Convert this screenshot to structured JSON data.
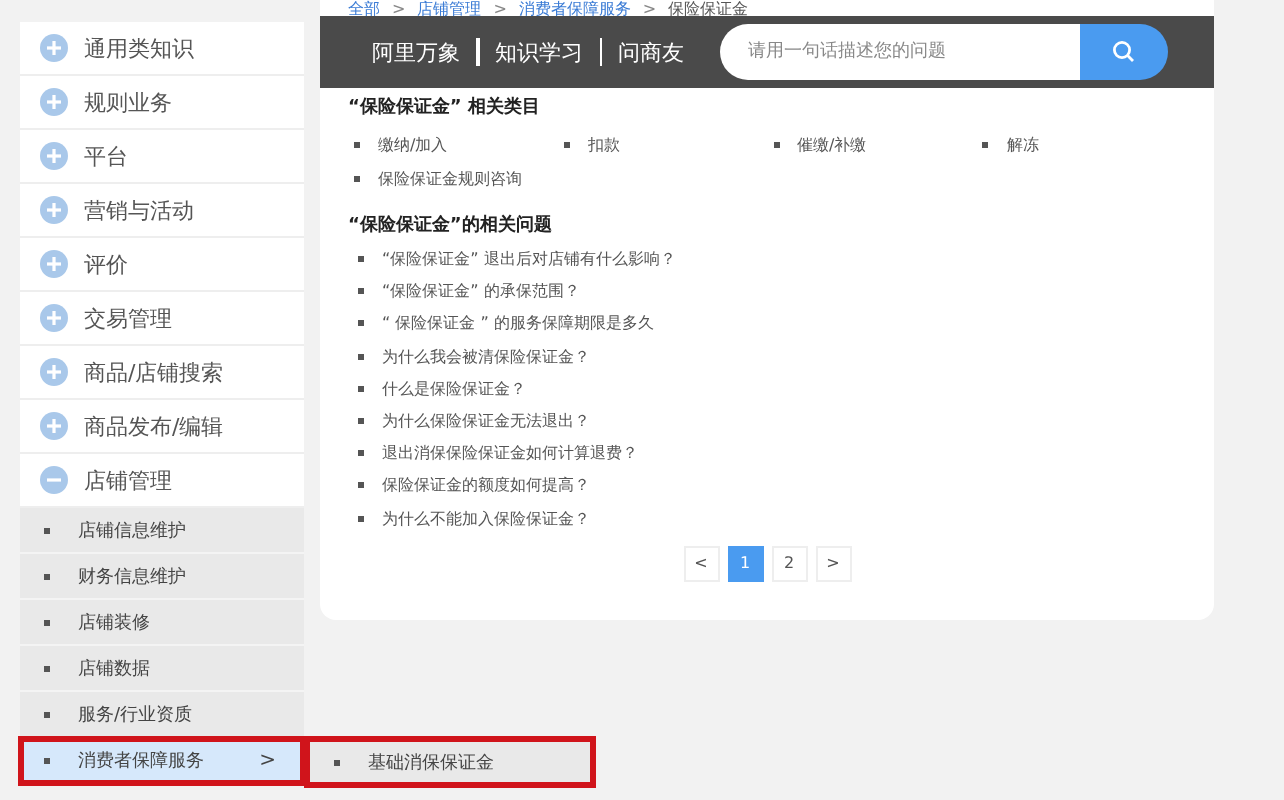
{
  "breadcrumb": [
    "全部",
    "店铺管理",
    "消费者保障服务",
    "保险保证金"
  ],
  "breadcrumb_separator": ">",
  "header_nav": [
    "阿里万象",
    "知识学习",
    "问商友"
  ],
  "search": {
    "placeholder": "请用一句话描述您的问题"
  },
  "sidebar": {
    "items": [
      {
        "label": "通用类知识",
        "expanded": false
      },
      {
        "label": "规则业务",
        "expanded": false
      },
      {
        "label": "平台",
        "expanded": false
      },
      {
        "label": "营销与活动",
        "expanded": false
      },
      {
        "label": "评价",
        "expanded": false
      },
      {
        "label": "交易管理",
        "expanded": false
      },
      {
        "label": "商品/店铺搜索",
        "expanded": false
      },
      {
        "label": "商品发布/编辑",
        "expanded": false
      },
      {
        "label": "店铺管理",
        "expanded": true,
        "children": [
          {
            "label": "店铺信息维护",
            "selected": false
          },
          {
            "label": "财务信息维护",
            "selected": false
          },
          {
            "label": "店铺装修",
            "selected": false
          },
          {
            "label": "店铺数据",
            "selected": false
          },
          {
            "label": "服务/行业资质",
            "selected": false
          },
          {
            "label": "消费者保障服务",
            "selected": true,
            "arrow": ">",
            "children": [
              {
                "label": "基础消保保证金"
              }
            ]
          }
        ]
      }
    ]
  },
  "categories": {
    "title": "“保险保证金” 相关类目",
    "items": [
      "缴纳/加入",
      "扣款",
      "催缴/补缴",
      "解冻",
      "保险保证金规则咨询"
    ]
  },
  "questions": {
    "title": "“保险保证金”的相关问题",
    "items": [
      "“保险保证金” 退出后对店铺有什么影响？",
      "“保险保证金” 的承保范围？",
      "“ 保险保证金 ” 的服务保障期限是多久",
      "为什么我会被清保险保证金？",
      "什么是保险保证金？",
      "为什么保险保证金无法退出？",
      "退出消保保险保证金如何计算退费？",
      "保险保证金的额度如何提高？",
      "为什么不能加入保险保证金？"
    ]
  },
  "pagination": {
    "prev": "<",
    "next": ">",
    "pages": [
      {
        "label": "1",
        "selected": true
      },
      {
        "label": "2",
        "selected": false
      }
    ]
  }
}
